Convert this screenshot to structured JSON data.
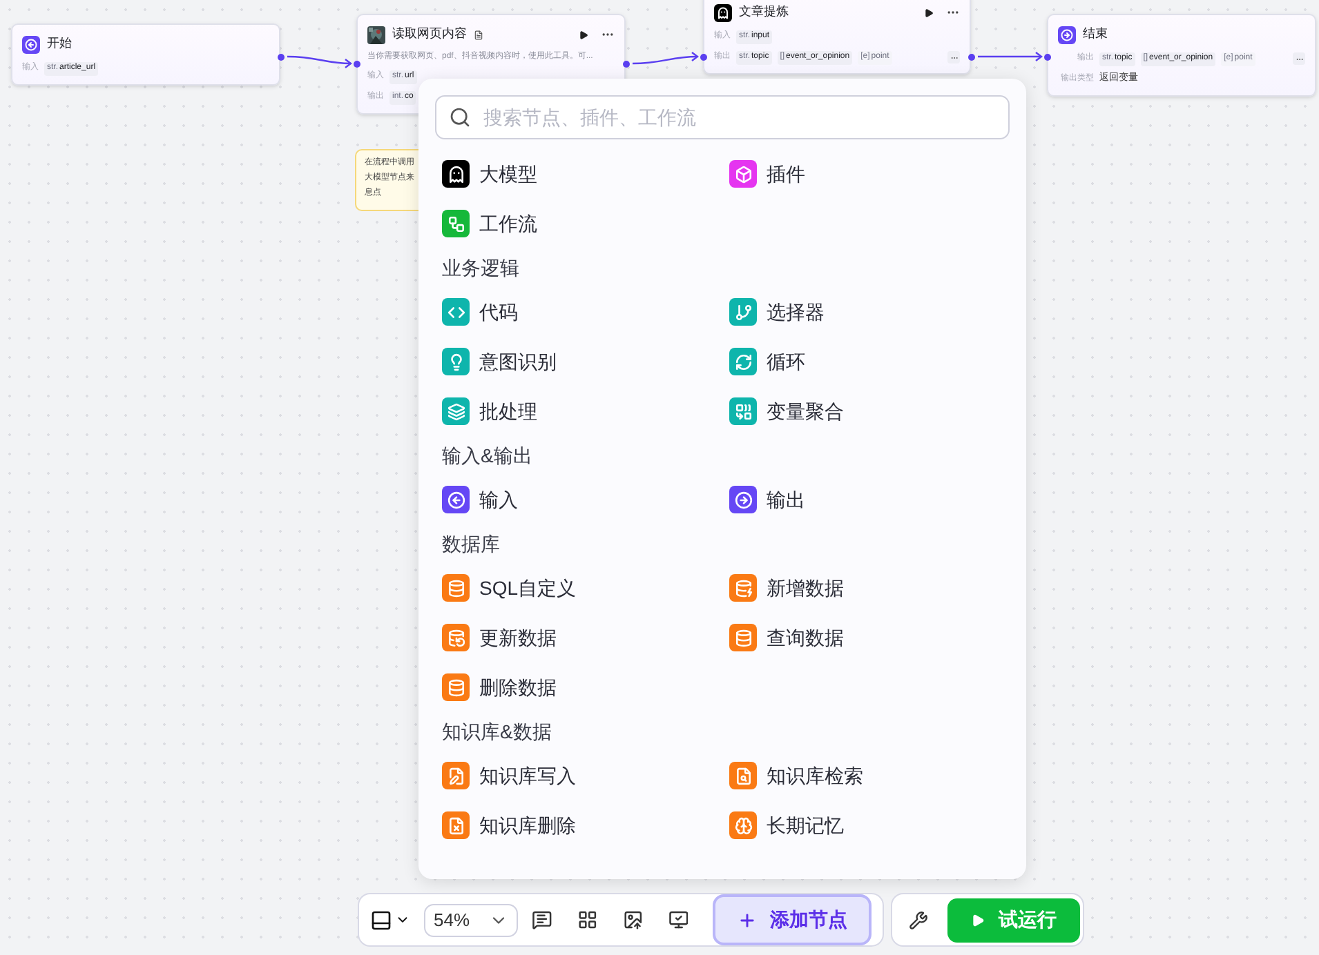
{
  "nodes": [
    {
      "title": "开始",
      "kind": "start",
      "actions": false,
      "rows": [
        {
          "label": "输入",
          "overflow": false,
          "chips": [
            {
              "type": "str.",
              "name": "article_url",
              "faded": false
            }
          ]
        }
      ]
    },
    {
      "title": "读取网页内容",
      "kind": "plugin",
      "actions": true,
      "description": "当你需要获取网页、pdf、抖音视频内容时，使用此工具。可...",
      "rows": [
        {
          "label": "输入",
          "chips": [
            {
              "type": "str.",
              "name": "url",
              "faded": false
            }
          ]
        },
        {
          "label": "输出",
          "chips": [
            {
              "type": "int.",
              "name": "co",
              "faded": false
            }
          ]
        }
      ]
    },
    {
      "title": "文章提炼",
      "kind": "llm",
      "actions": true,
      "rows": [
        {
          "label": "输入",
          "overflow": false,
          "chips": [
            {
              "type": "str.",
              "name": "input",
              "faded": false
            }
          ]
        },
        {
          "label": "输出",
          "overflow": true,
          "chips": [
            {
              "type": "str.",
              "name": "topic",
              "faded": false
            },
            {
              "type": "[]",
              "name": "event_or_opinion",
              "faded": false
            },
            {
              "type": "[e]",
              "name": "point",
              "faded": true
            }
          ]
        }
      ]
    },
    {
      "title": "结束",
      "kind": "end",
      "actions": false,
      "rows": [
        {
          "label": "输出",
          "overflow": true,
          "chips": [
            {
              "type": "str.",
              "name": "topic",
              "faded": false
            },
            {
              "type": "[]",
              "name": "event_or_opinion",
              "faded": false
            },
            {
              "type": "[e]",
              "name": "point",
              "faded": true
            }
          ]
        },
        {
          "label": "输出类型",
          "value": "返回变量"
        }
      ]
    }
  ],
  "note": {
    "lines": [
      "在流程中调用",
      "大模型节点来",
      "息点"
    ]
  },
  "add_node_menu": {
    "search": {
      "placeholder": "搜索节点、插件、工作流"
    },
    "sections": [
      {
        "items": [
          {
            "label": "大模型",
            "kind": "llm",
            "color": "#000000"
          },
          {
            "label": "插件",
            "kind": "plugin",
            "color": "#e535f0"
          },
          {
            "label": "工作流",
            "kind": "workflow",
            "color": "#16b83a"
          }
        ]
      },
      {
        "title": "业务逻辑",
        "items": [
          {
            "label": "代码",
            "kind": "code",
            "color": "#0eb5ac"
          },
          {
            "label": "选择器",
            "kind": "selector",
            "color": "#0eb5ac"
          },
          {
            "label": "意图识别",
            "kind": "intent",
            "color": "#0eb5ac"
          },
          {
            "label": "循环",
            "kind": "loop",
            "color": "#0eb5ac"
          },
          {
            "label": "批处理",
            "kind": "batch",
            "color": "#0eb5ac"
          },
          {
            "label": "变量聚合",
            "kind": "aggregate",
            "color": "#0eb5ac"
          }
        ]
      },
      {
        "title": "输入&输出",
        "items": [
          {
            "label": "输入",
            "kind": "input",
            "color": "#6547f5"
          },
          {
            "label": "输出",
            "kind": "output",
            "color": "#6547f5"
          }
        ]
      },
      {
        "title": "数据库",
        "items": [
          {
            "label": "SQL自定义",
            "kind": "db",
            "color": "#fa7a14"
          },
          {
            "label": "新增数据",
            "kind": "db-add",
            "color": "#fa7a14"
          },
          {
            "label": "更新数据",
            "kind": "db-update",
            "color": "#fa7a14"
          },
          {
            "label": "查询数据",
            "kind": "db-query",
            "color": "#fa7a14"
          },
          {
            "label": "删除数据",
            "kind": "db-delete",
            "color": "#fa7a14"
          }
        ]
      },
      {
        "title": "知识库&数据",
        "items": [
          {
            "label": "知识库写入",
            "kind": "kb-write",
            "color": "#fa7a14"
          },
          {
            "label": "知识库检索",
            "kind": "kb-search",
            "color": "#fa7a14"
          },
          {
            "label": "知识库删除",
            "kind": "kb-delete",
            "color": "#fa7a14"
          },
          {
            "label": "长期记忆",
            "kind": "memory",
            "color": "#fa7a14"
          }
        ]
      }
    ]
  },
  "toolbar": {
    "zoom": "54%",
    "add_node": "添加节点",
    "test_run": "试运行"
  }
}
